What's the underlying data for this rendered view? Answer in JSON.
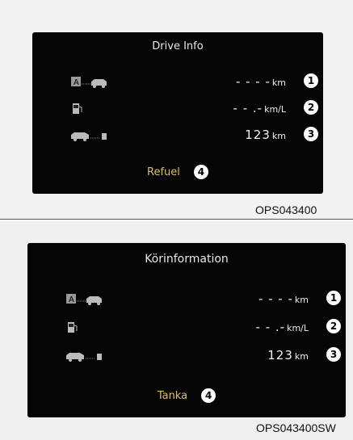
{
  "top": {
    "title": "Drive Info",
    "rows": [
      {
        "icon": "range-to-empty-icon",
        "value": "- - - -",
        "unit": "km",
        "badge": "1"
      },
      {
        "icon": "fuel-pump-icon",
        "value": "- - .-",
        "unit": "km/L",
        "badge": "2"
      },
      {
        "icon": "car-to-pump-icon",
        "value": "123",
        "unit": "km",
        "badge": "3"
      }
    ],
    "refuel": {
      "label": "Refuel",
      "badge": "4"
    },
    "code": "OPS043400"
  },
  "bottom": {
    "title": "Körinformation",
    "rows": [
      {
        "icon": "range-to-empty-icon",
        "value": "- - - -",
        "unit": "km",
        "badge": "1"
      },
      {
        "icon": "fuel-pump-icon",
        "value": "- - .-",
        "unit": "km/L",
        "badge": "2"
      },
      {
        "icon": "car-to-pump-icon",
        "value": "123",
        "unit": "km",
        "badge": "3"
      }
    ],
    "refuel": {
      "label": "Tanka",
      "badge": "4"
    },
    "code": "OPS043400SW"
  },
  "colors": {
    "screen": "#050505",
    "text": "#f0f0f0",
    "refuel": "#d9c25c",
    "badge": "#ffffff"
  }
}
